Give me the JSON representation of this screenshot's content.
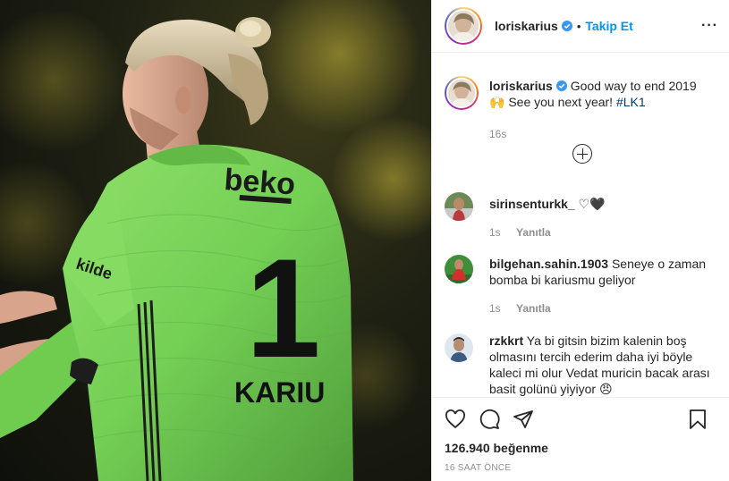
{
  "header": {
    "username": "loriskarius",
    "separator": "•",
    "follow_label": "Takip Et",
    "more_label": "···"
  },
  "caption": {
    "username": "loriskarius",
    "text_line1": "Good way to end 2019",
    "emoji": "🙌",
    "text_line2": "See you next year!",
    "hashtag": "#LK1",
    "time": "16s"
  },
  "comments": [
    {
      "username": "sirinsenturkk_",
      "text": "♡🖤",
      "time": "1s",
      "reply": "Yanıtla"
    },
    {
      "username": "bilgehan.sahin.1903",
      "text": "Seneye o zaman bomba bi kariusmu geliyor",
      "time": "1s",
      "reply": "Yanıtla"
    },
    {
      "username": "rzkkrt",
      "text": "Ya bi gitsin bizim kalenin boş olmasını tercih ederim daha iyi böyle kaleci mi olur Vedat muricin bacak arası basit golünü yiyiyor 😠",
      "time": "",
      "reply": ""
    }
  ],
  "footer": {
    "likes": "126.940 beğenme",
    "time_ago": "16 SAAT ÖNCE"
  },
  "photo": {
    "jersey_brand": "beko",
    "jersey_number": "1",
    "jersey_name": "KARIU",
    "sleeve_text": "kilde"
  },
  "icons": {
    "verified": "verified-badge-icon",
    "like": "heart-icon",
    "comment": "comment-icon",
    "share": "paper-plane-icon",
    "save": "bookmark-icon",
    "load_more": "plus-circle-icon"
  },
  "colors": {
    "link_blue": "#0095f6",
    "hashtag": "#00376b",
    "muted": "#8e8e8e",
    "jersey_green": "#7ed957"
  }
}
